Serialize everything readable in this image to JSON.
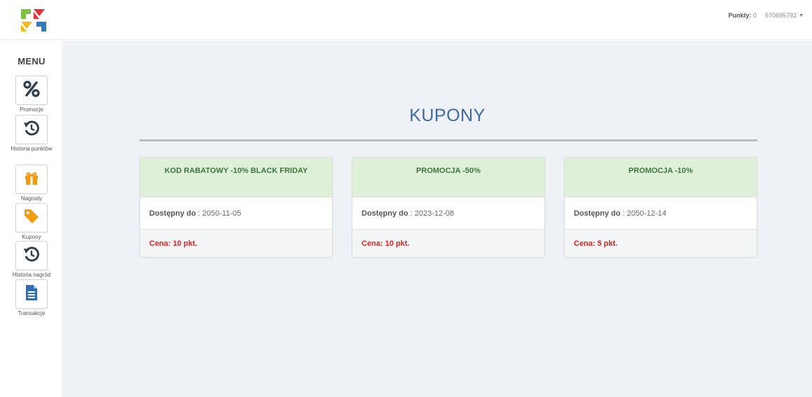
{
  "header": {
    "points_label": "Punkty:",
    "points_value": "0",
    "user_id": "570695792"
  },
  "sidebar": {
    "title": "MENU",
    "items": [
      {
        "label": "Promocje",
        "icon": "percent-icon"
      },
      {
        "label": "Historia punktów",
        "icon": "history-icon"
      },
      {
        "label": "Nagrody",
        "icon": "gift-icon"
      },
      {
        "label": "Kupony",
        "icon": "tag-icon"
      },
      {
        "label": "Historia nagród",
        "icon": "history-icon"
      },
      {
        "label": "Transakcje",
        "icon": "document-icon"
      }
    ]
  },
  "main": {
    "title": "KUPONY",
    "coupons": [
      {
        "name": "KOD RABATOWY -10% BLACK FRIDAY",
        "available_label": "Dostępny do",
        "available_date": ": 2050-11-05",
        "price": "Cena: 10 pkt."
      },
      {
        "name": "PROMOCJA -50%",
        "available_label": "Dostępny do",
        "available_date": ": 2023-12-08",
        "price": "Cena: 10 pkt."
      },
      {
        "name": "PROMOCJA -10%",
        "available_label": "Dostępny do",
        "available_date": ": 2050-12-14",
        "price": "Cena: 5 pkt."
      }
    ]
  },
  "colors": {
    "title_blue": "#3e69a9",
    "card_head_green": "#dff0d8",
    "card_head_text": "#3c763d",
    "price_red": "#d9241f",
    "icon_navy": "#2c3e50",
    "icon_orange": "#f39c12",
    "icon_blue": "#2f6db5"
  }
}
